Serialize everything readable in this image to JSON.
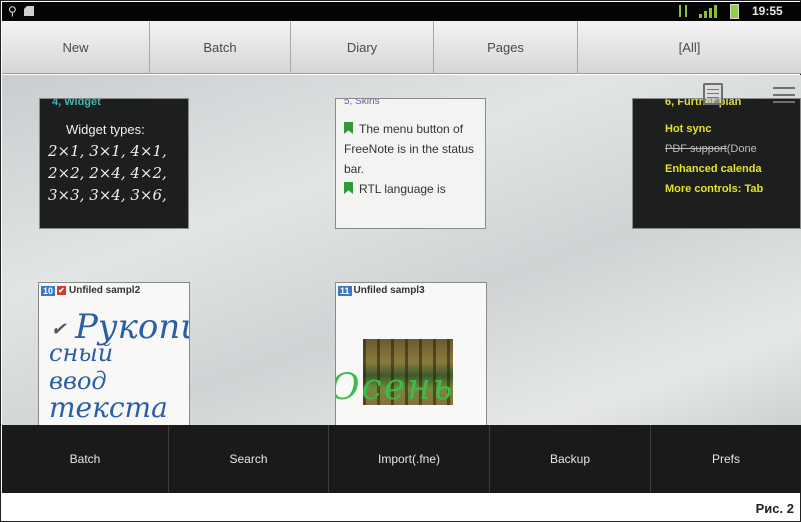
{
  "status_bar": {
    "time": "19:55",
    "icons": [
      "usb-icon",
      "sd-card-icon",
      "hourglass-icon",
      "signal-icon",
      "battery-icon"
    ],
    "colors": {
      "background": "#050505",
      "signal": "#8fbf2f",
      "battery": "#8fd23a"
    }
  },
  "tabs": [
    {
      "label": "New"
    },
    {
      "label": "Batch"
    },
    {
      "label": "Diary"
    },
    {
      "label": "Pages"
    },
    {
      "label": "[All]"
    }
  ],
  "notes": {
    "widget": {
      "title": "4, Widget",
      "types_label": "Widget types:",
      "sizes": "2×1, 3×1, 4×1, 2×2, 2×4, 4×2, 3×3, 3×4, 3×6,"
    },
    "skins": {
      "title": "5, Skins",
      "line1": "The menu button of FreeNote is in the status bar.",
      "line2": "RTL language is"
    },
    "plan": {
      "title": "6, Further plan",
      "items": [
        "Hot sync",
        "PDF support",
        "(Done",
        "Enhanced calenda",
        "More controls: Tab"
      ]
    },
    "sample2": {
      "number": "10",
      "title": "Unfiled sampl2",
      "hand_lines": [
        "Рукопи",
        "сный",
        "ввод",
        "текста"
      ]
    },
    "sample3": {
      "number": "11",
      "title": "Unfiled sampl3",
      "hand": "Осень"
    }
  },
  "toolbar_icons": [
    "calendar-icon",
    "menu-icon"
  ],
  "actions": [
    {
      "label": "Batch"
    },
    {
      "label": "Search"
    },
    {
      "label": "Import(.fne)"
    },
    {
      "label": "Backup"
    },
    {
      "label": "Prefs"
    }
  ],
  "caption": "Рис. 2"
}
